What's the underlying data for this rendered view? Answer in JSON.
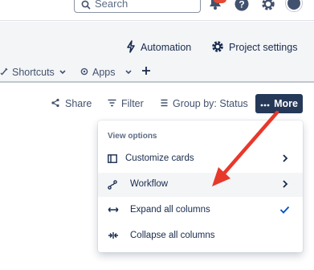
{
  "topbar": {
    "search_placeholder": "Search",
    "icons": [
      "search-icon",
      "notifications-icon",
      "help-icon",
      "settings-icon",
      "avatar"
    ]
  },
  "project_header": {
    "automation_label": "Automation",
    "settings_label": "Project settings"
  },
  "project_nav": {
    "shortcuts_label": "Shortcuts",
    "apps_label": "Apps"
  },
  "board_toolbar": {
    "share_label": "Share",
    "filter_label": "Filter",
    "group_by_label": "Group by: Status",
    "more_label": "More"
  },
  "more_menu": {
    "heading": "View options",
    "items": [
      {
        "label": "Customize cards",
        "icon": "cards-icon",
        "trailing": "chevron-right"
      },
      {
        "label": "Workflow",
        "icon": "workflow-icon",
        "trailing": "chevron-right",
        "highlighted": true
      },
      {
        "label": "Expand all columns",
        "icon": "expand-icon",
        "trailing": "checkmark",
        "checked": true
      },
      {
        "label": "Collapse all columns",
        "icon": "collapse-icon",
        "trailing": ""
      }
    ]
  },
  "colors": {
    "more_button_bg": "#253858",
    "text_primary": "#172b4d",
    "text_secondary": "#42526e",
    "check_blue": "#0052cc",
    "annotation_red": "#e8382b",
    "menu_hover_bg": "#f4f5f7",
    "header_bg": "#f4f5f7"
  }
}
